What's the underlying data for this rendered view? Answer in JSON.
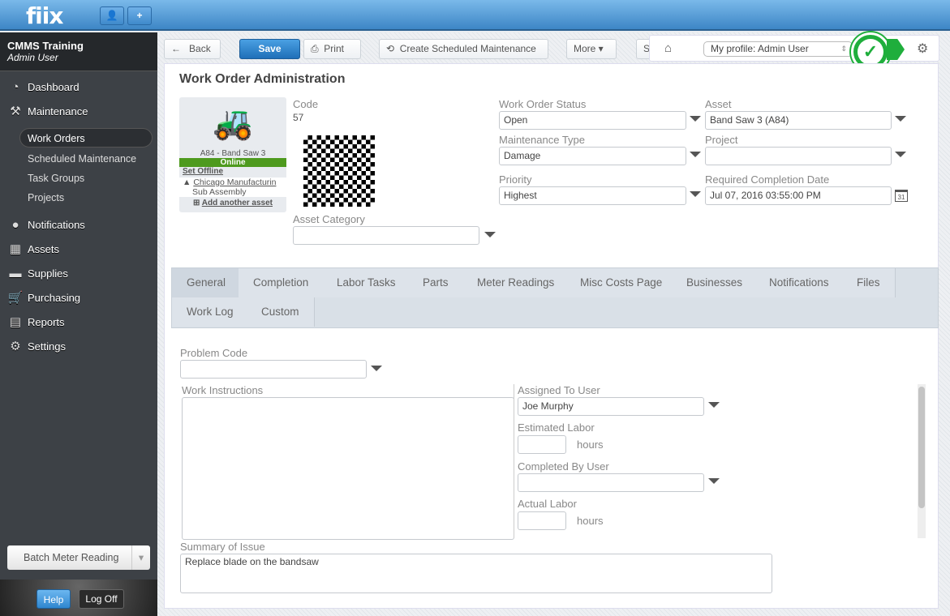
{
  "header": {
    "logo": "fiix",
    "user_btn": "user-icon",
    "add_btn": "+"
  },
  "sidebar": {
    "account": "CMMS Training",
    "user": "Admin User",
    "items": [
      {
        "label": "Dashboard",
        "icon": "◔"
      },
      {
        "label": "Maintenance",
        "icon": "⚒"
      }
    ],
    "sub": [
      "Work Orders",
      "Scheduled Maintenance",
      "Task Groups",
      "Projects"
    ],
    "items2": [
      {
        "label": "Notifications",
        "icon": "●"
      },
      {
        "label": "Assets",
        "icon": "▦"
      },
      {
        "label": "Supplies",
        "icon": "▬"
      },
      {
        "label": "Purchasing",
        "icon": "🛒"
      },
      {
        "label": "Reports",
        "icon": "▤"
      },
      {
        "label": "Settings",
        "icon": "⚙"
      }
    ],
    "batch": "Batch Meter Reading",
    "help": "Help",
    "logoff": "Log Off"
  },
  "toolbar": {
    "back": "Back",
    "save": "Save",
    "print": "Print",
    "csm": "Create Scheduled Maintenance",
    "more": "More",
    "s": "S",
    "profile": "My profile: Admin User"
  },
  "form": {
    "title": "Work Order Administration",
    "asset_card": {
      "name": "A84 - Band Saw 3",
      "status": "Online",
      "set_offline": "Set Offline",
      "location": "Chicago Manufacturin",
      "sub": "Sub Assembly",
      "add": "Add another asset"
    },
    "code_label": "Code",
    "code": "57",
    "asset_category_label": "Asset Category",
    "asset_category": "",
    "status_label": "Work Order Status",
    "status": "Open",
    "mtype_label": "Maintenance Type",
    "mtype": "Damage",
    "priority_label": "Priority",
    "priority": "Highest",
    "asset_label": "Asset",
    "asset": "Band Saw 3 (A84)",
    "project_label": "Project",
    "project": "",
    "rcd_label": "Required Completion Date",
    "rcd": "Jul 07, 2016 03:55:00 PM",
    "cal": "31"
  },
  "tabs": [
    "General",
    "Completion",
    "Labor Tasks",
    "Parts",
    "Meter Readings",
    "Misc Costs Page",
    "Businesses",
    "Notifications",
    "Files",
    "Work Log",
    "Custom"
  ],
  "general": {
    "problem_code_label": "Problem Code",
    "wi_label": "Work Instructions",
    "assigned_label": "Assigned To User",
    "assigned": "Joe Murphy",
    "est_label": "Estimated Labor",
    "hours": "hours",
    "completed_label": "Completed By User",
    "actual_label": "Actual Labor",
    "summary_label": "Summary of Issue",
    "summary": "Replace blade on the bandsaw"
  }
}
